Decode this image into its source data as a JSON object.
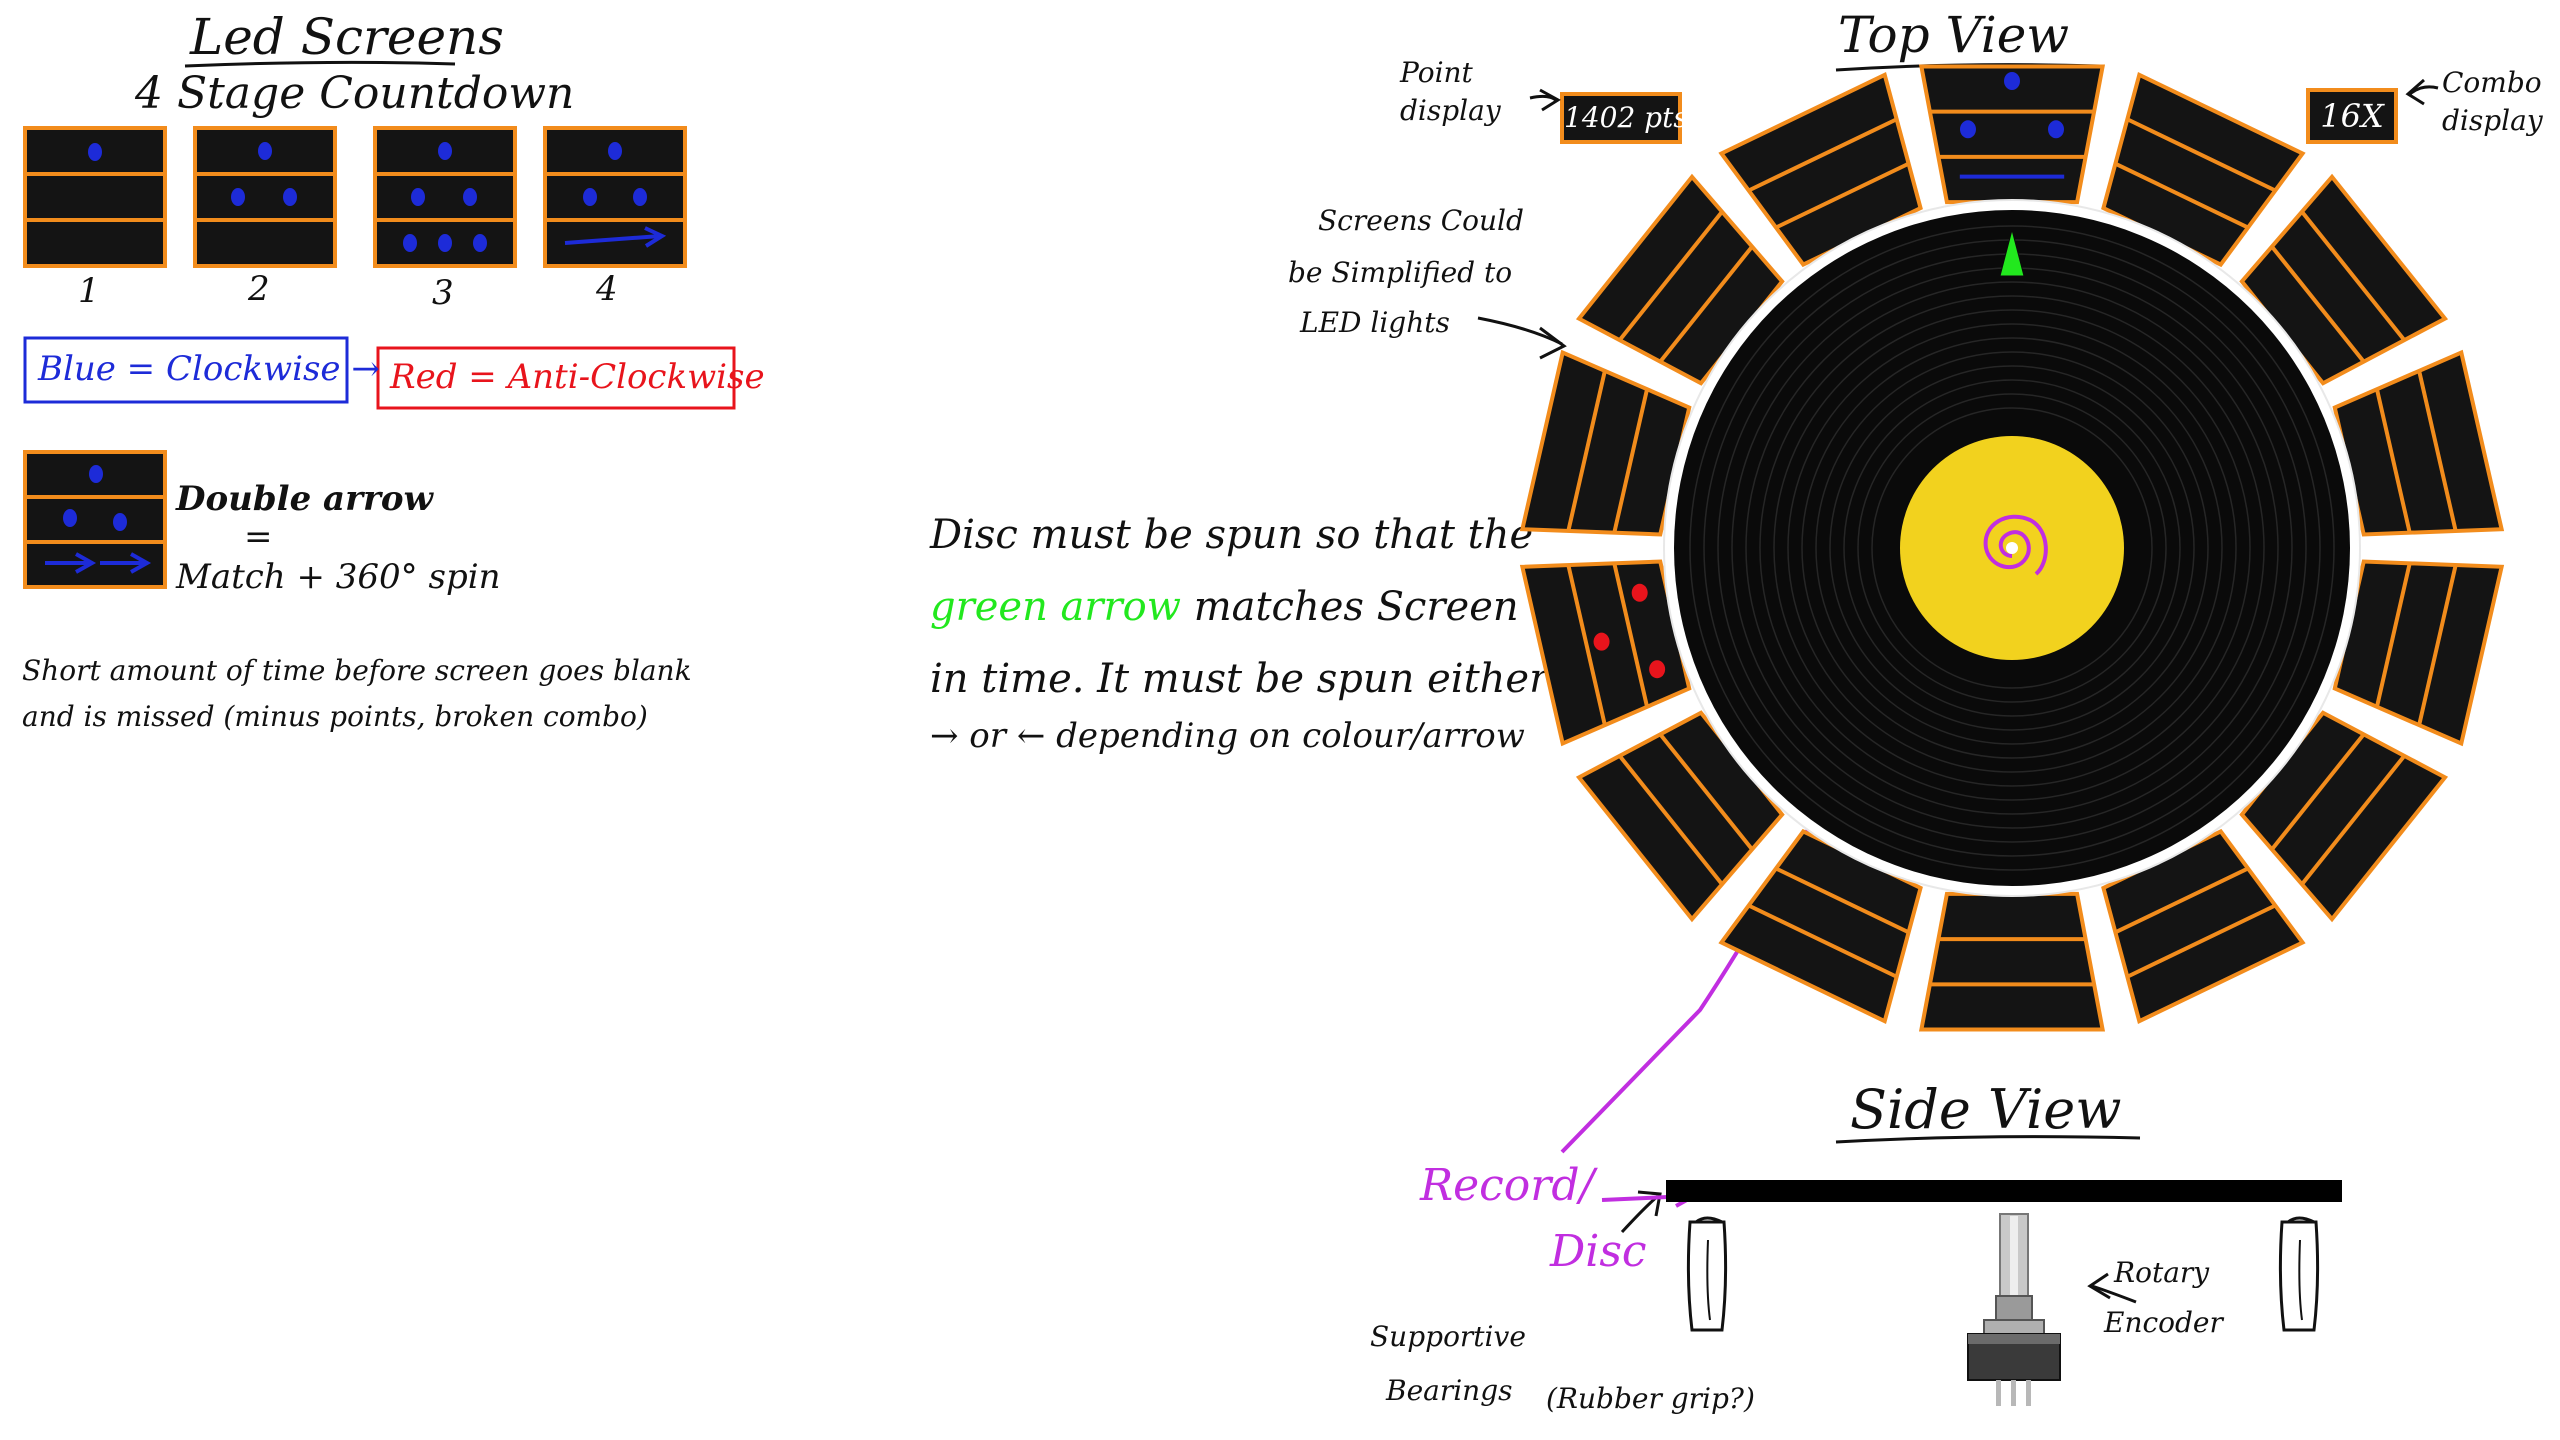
{
  "led_section": {
    "title": "Led Screens",
    "subtitle": "4 Stage Countdown",
    "stage_labels": [
      "1",
      "2",
      "3",
      "4"
    ],
    "blue_legend": "Blue = Clockwise →",
    "red_legend": "Red = Anti-Clockwise",
    "double_arrow_line1": "Double arrow",
    "double_arrow_eq": "=",
    "double_arrow_line2": "Match + 360° spin",
    "timeout_line1": "Short amount of time before screen goes blank",
    "timeout_line2": "and is missed (minus points, broken combo)",
    "colors": {
      "blue": "#1d2bd8",
      "red": "#e8141c",
      "orange": "#f28c1c",
      "screen": "#141414"
    }
  },
  "instructions": {
    "line1": "Disc must be spun so that the",
    "line2_highlight": "green arrow",
    "line2_rest": "matches Screen",
    "line3": "in time. It must be spun either",
    "line4": "→ or ← depending on colour/arrow",
    "highlight_color": "#22e81e"
  },
  "top_view": {
    "title": "Top View",
    "point_display_label_1": "Point",
    "point_display_label_2": "display",
    "point_display_value": "1402 pts",
    "combo_display_label_1": "Combo",
    "combo_display_label_2": "display",
    "combo_display_value": "16X",
    "screens_note_1": "Screens Could",
    "screens_note_2": "be Simplified to",
    "screens_note_3": "LED lights",
    "label_color": "#f2d21e",
    "pointer_color": "#22e81e"
  },
  "side_view": {
    "title": "Side View",
    "record_label_1": "Record/",
    "record_label_2": "Disc",
    "bearings_label_1": "Supportive",
    "bearings_label_2": "Bearings",
    "rubber_note": "(Rubber grip?)",
    "encoder_label_1": "Rotary",
    "encoder_label_2": "Encoder",
    "purple": "#c12ee0"
  }
}
